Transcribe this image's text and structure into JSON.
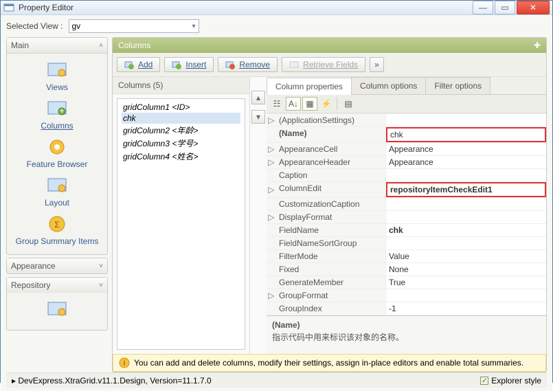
{
  "window": {
    "title": "Property Editor"
  },
  "selected_view": {
    "label": "Selected View :",
    "value": "gv"
  },
  "nav": {
    "main": {
      "title": "Main",
      "items": [
        {
          "name": "views",
          "label": "Views"
        },
        {
          "name": "columns",
          "label": "Columns"
        },
        {
          "name": "feature_browser",
          "label": "Feature Browser"
        },
        {
          "name": "layout",
          "label": "Layout"
        },
        {
          "name": "group_summary",
          "label": "Group Summary Items"
        }
      ]
    },
    "appearance": {
      "title": "Appearance"
    },
    "repository": {
      "title": "Repository"
    }
  },
  "columns": {
    "section_title": "Columns",
    "toolbar": {
      "add": "Add",
      "insert": "Insert",
      "remove": "Remove",
      "retrieve": "Retrieve Fields"
    },
    "list_header": "Columns (5)",
    "items": [
      "gridColumn1 <ID>",
      "chk",
      "gridColumn2 <年龄>",
      "gridColumn3 <学号>",
      "gridColumn4 <姓名>"
    ],
    "selected_index": 1
  },
  "tabs": {
    "props": "Column properties",
    "opts": "Column options",
    "filter": "Filter options"
  },
  "propgrid": {
    "rows": [
      {
        "exp": "▷",
        "name": "(ApplicationSettings)",
        "value": ""
      },
      {
        "exp": "",
        "name": "(Name)",
        "value": "chk",
        "boldName": true,
        "redVal": true
      },
      {
        "exp": "▷",
        "name": "AppearanceCell",
        "value": "Appearance"
      },
      {
        "exp": "▷",
        "name": "AppearanceHeader",
        "value": "Appearance"
      },
      {
        "exp": "",
        "name": "Caption",
        "value": ""
      },
      {
        "exp": "▷",
        "name": "ColumnEdit",
        "value": "repositoryItemCheckEdit1",
        "boldVal": true,
        "redVal": true
      },
      {
        "exp": "",
        "name": "CustomizationCaption",
        "value": ""
      },
      {
        "exp": "▷",
        "name": "DisplayFormat",
        "value": ""
      },
      {
        "exp": "",
        "name": "FieldName",
        "value": "chk",
        "boldVal": true
      },
      {
        "exp": "",
        "name": "FieldNameSortGroup",
        "value": ""
      },
      {
        "exp": "",
        "name": "FilterMode",
        "value": "Value"
      },
      {
        "exp": "",
        "name": "Fixed",
        "value": "None"
      },
      {
        "exp": "",
        "name": "GenerateMember",
        "value": "True"
      },
      {
        "exp": "▷",
        "name": "GroupFormat",
        "value": ""
      },
      {
        "exp": "",
        "name": "GroupIndex",
        "value": "-1"
      }
    ],
    "desc": {
      "name": "(Name)",
      "text": "指示代码中用来标识该对象的名称。"
    }
  },
  "hint": "You can add and delete columns, modify their settings, assign in-place editors and enable total summaries.",
  "status": {
    "version": "DevExpress.XtraGrid.v11.1.Design, Version=11.1.7.0",
    "explorer": "Explorer style"
  }
}
